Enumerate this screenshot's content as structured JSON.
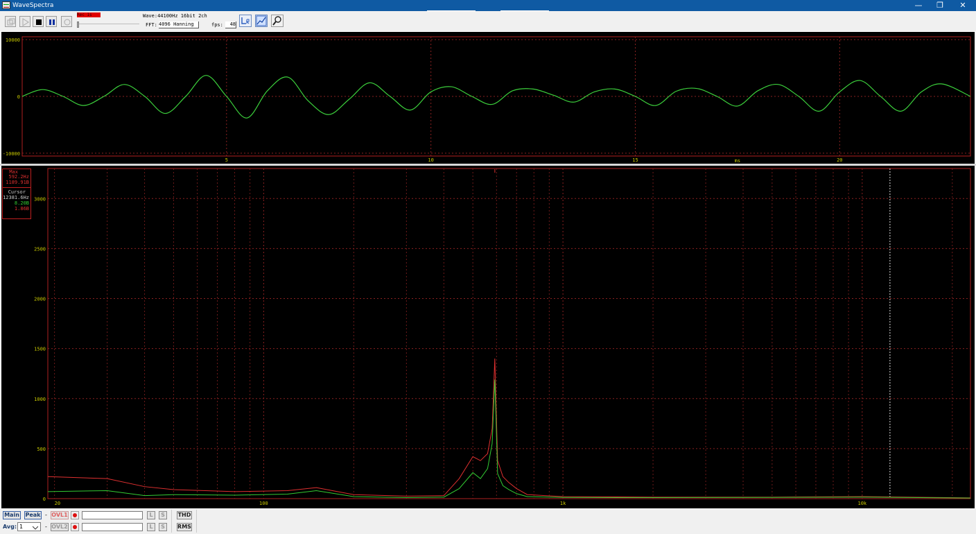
{
  "window": {
    "title": "WaveSpectra",
    "controls": {
      "minimize": "—",
      "restore": "❐",
      "close": "✕"
    }
  },
  "toolbar": {
    "record_badge": "Rec 1s",
    "wave_info": "Wave:44100Hz 16bit 2ch",
    "fft_label": "FFT:",
    "fft_value": "4096 Hanning",
    "fps_label": "fps:",
    "fps_value": "48",
    "buttons": [
      "copy-icon",
      "play-icon",
      "stop-icon",
      "pause-icon",
      "refresh-icon",
      "lr-channel-icon",
      "spectrum-settings-icon",
      "zoom-icon"
    ]
  },
  "wave_panel": {
    "y_ticks": [
      "10000",
      "0",
      "-10000"
    ],
    "y_tick_values": [
      10000,
      0,
      -10000
    ],
    "x_ticks": [
      "5",
      "10",
      "15",
      "20"
    ],
    "x_tick_values": [
      5,
      10,
      15,
      20
    ],
    "x_unit": "ms"
  },
  "spectrum_panel": {
    "y_ticks": [
      "3000",
      "2500",
      "2000",
      "1500",
      "1000",
      "500",
      "0"
    ],
    "y_tick_values": [
      3000,
      2500,
      2000,
      1500,
      1000,
      500,
      0
    ],
    "x_ticks": [
      "20",
      "100",
      "1k",
      "10k"
    ],
    "x_tick_values": [
      20,
      100,
      1000,
      10000
    ],
    "info": {
      "max_label": "Max",
      "max_freq": "592.2Hz",
      "max_value": "1189.91B",
      "cursor_label": "Cursor",
      "cursor_freq": "12381.6Hz",
      "cursor_value_green": "8.20B",
      "cursor_value_red": "1.86B"
    }
  },
  "chart_data": [
    {
      "type": "line",
      "x_unit": "ms",
      "xlim": [
        0,
        23.2
      ],
      "ylim": [
        -10500,
        10500
      ],
      "grid": true,
      "series": [
        {
          "color": "#3cd03c",
          "x": [
            0,
            0.5,
            1.0,
            1.5,
            2.0,
            2.5,
            3.0,
            3.5,
            4.0,
            4.5,
            5.0,
            5.5,
            6.0,
            6.5,
            7.0,
            7.5,
            8.0,
            8.5,
            9.0,
            9.5,
            10.0,
            10.5,
            11.0,
            11.5,
            12.0,
            12.5,
            13.0,
            13.5,
            14.0,
            14.5,
            15.0,
            15.5,
            16.0,
            16.5,
            17.0,
            17.5,
            18.0,
            18.5,
            19.0,
            19.5,
            20.0,
            20.5,
            21.0,
            21.5,
            22.0,
            22.5,
            23.2
          ],
          "y": [
            0,
            1200,
            0,
            -1600,
            0,
            2100,
            0,
            -3000,
            0,
            3700,
            0,
            -3800,
            1000,
            3400,
            -800,
            -3200,
            -500,
            2400,
            0,
            -2400,
            800,
            1700,
            0,
            -1400,
            1000,
            1300,
            200,
            -1000,
            800,
            1300,
            0,
            -1600,
            900,
            1400,
            0,
            -1700,
            1000,
            2100,
            0,
            -2600,
            800,
            2800,
            0,
            -2600,
            800,
            2200,
            0
          ]
        }
      ]
    },
    {
      "type": "line",
      "x_scale": "log",
      "xlim": [
        19,
        23000
      ],
      "ylim": [
        0,
        3300
      ],
      "grid": true,
      "series": [
        {
          "color": "#e03030",
          "x": [
            19,
            30,
            40,
            50,
            80,
            120,
            150,
            200,
            300,
            400,
            450,
            500,
            530,
            560,
            580,
            592,
            605,
            630,
            660,
            700,
            760,
            1000,
            2000,
            5000,
            10000,
            23000
          ],
          "y": [
            220,
            200,
            120,
            90,
            70,
            80,
            110,
            40,
            25,
            30,
            200,
            420,
            380,
            450,
            700,
            1400,
            380,
            220,
            160,
            100,
            40,
            20,
            15,
            15,
            20,
            8
          ]
        },
        {
          "color": "#33cc33",
          "x": [
            19,
            30,
            40,
            50,
            80,
            120,
            150,
            200,
            300,
            400,
            450,
            500,
            530,
            560,
            580,
            592,
            605,
            630,
            660,
            700,
            760,
            1000,
            2000,
            5000,
            10000,
            23000
          ],
          "y": [
            70,
            80,
            30,
            40,
            35,
            45,
            80,
            20,
            10,
            15,
            100,
            260,
            200,
            300,
            550,
            1190,
            250,
            130,
            90,
            50,
            20,
            12,
            10,
            12,
            15,
            6
          ]
        }
      ]
    }
  ],
  "bottom": {
    "main": "Main",
    "peak": "Peak",
    "dash1": "-",
    "ovl1": "OVL1",
    "ovl2": "OVL2",
    "l": "L",
    "s": "S",
    "thd": "THD",
    "rms": "RMS",
    "avg_label": "Avg:",
    "avg_value": "1",
    "dash2": "-"
  }
}
